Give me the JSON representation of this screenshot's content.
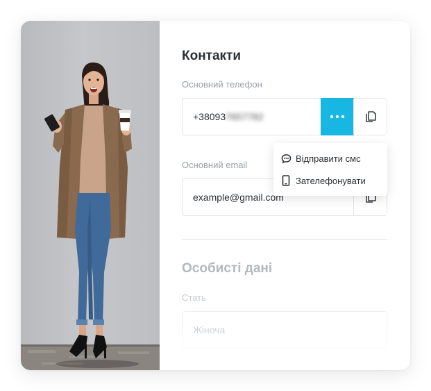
{
  "contacts": {
    "title": "Контакти",
    "phone_label": "Основний телефон",
    "phone_prefix": "+38093",
    "phone_hidden": "7657782",
    "email_label": "Основний email",
    "email_value": "example@gmail.com"
  },
  "menu": {
    "items": [
      {
        "label": "Відправити смс",
        "icon": "chat-bubble-icon"
      },
      {
        "label": "Зателефонувати",
        "icon": "mobile-phone-icon"
      }
    ]
  },
  "personal": {
    "title": "Особисті дані",
    "gender_label": "Стать",
    "gender_value": "Жіноча"
  },
  "colors": {
    "accent": "#17b7e3",
    "text": "#2b2f33",
    "muted": "#9aa0a6",
    "border": "#e3e6ea"
  }
}
